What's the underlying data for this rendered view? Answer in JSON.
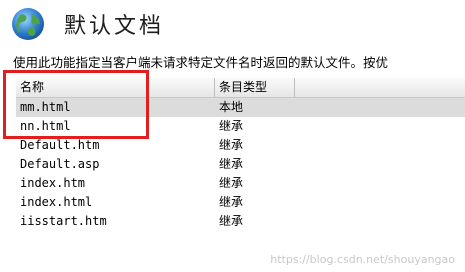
{
  "page": {
    "title": "默认文档",
    "description": "使用此功能指定当客户端未请求特定文件名时返回的默认文件。按优"
  },
  "table": {
    "columns": [
      "名称",
      "条目类型"
    ],
    "rows": [
      {
        "name": "mm.html",
        "type": "本地"
      },
      {
        "name": "nn.html",
        "type": "继承"
      },
      {
        "name": "Default.htm",
        "type": "继承"
      },
      {
        "name": "Default.asp",
        "type": "继承"
      },
      {
        "name": "index.htm",
        "type": "继承"
      },
      {
        "name": "index.html",
        "type": "继承"
      },
      {
        "name": "iisstart.htm",
        "type": "继承"
      }
    ]
  },
  "watermark": "https://blog.csdn.net/shouyangao",
  "colors": {
    "highlight": "#e02020",
    "selected_row": "#dcdcdc"
  },
  "icons": {
    "page_icon": "globe-icon"
  }
}
